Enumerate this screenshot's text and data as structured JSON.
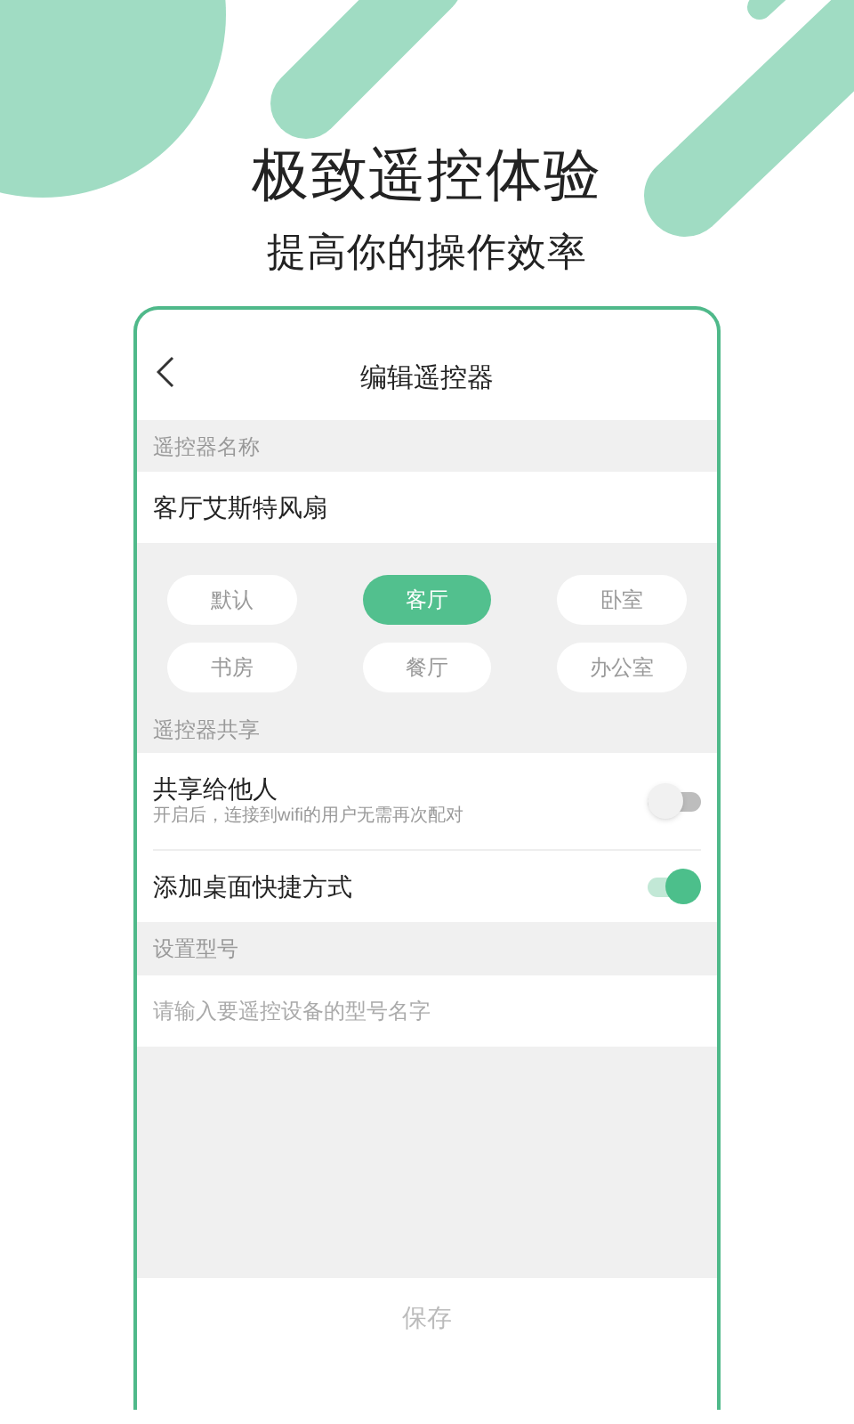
{
  "headline": "极致遥控体验",
  "subheadline": "提高你的操作效率",
  "screen": {
    "title": "编辑遥控器",
    "name_section": {
      "label": "遥控器名称",
      "value": "客厅艾斯特风扇"
    },
    "rooms": [
      {
        "label": "默认",
        "selected": false
      },
      {
        "label": "客厅",
        "selected": true
      },
      {
        "label": "卧室",
        "selected": false
      },
      {
        "label": "书房",
        "selected": false
      },
      {
        "label": "餐厅",
        "selected": false
      },
      {
        "label": "办公室",
        "selected": false
      }
    ],
    "share_section": {
      "label": "遥控器共享",
      "settings": [
        {
          "title": "共享给他人",
          "subtitle": "开启后，连接到wifi的用户无需再次配对",
          "on": false
        },
        {
          "title": "添加桌面快捷方式",
          "on": true
        }
      ]
    },
    "model_section": {
      "label": "设置型号",
      "placeholder": "请输入要遥控设备的型号名字"
    },
    "save_button": "保存"
  }
}
